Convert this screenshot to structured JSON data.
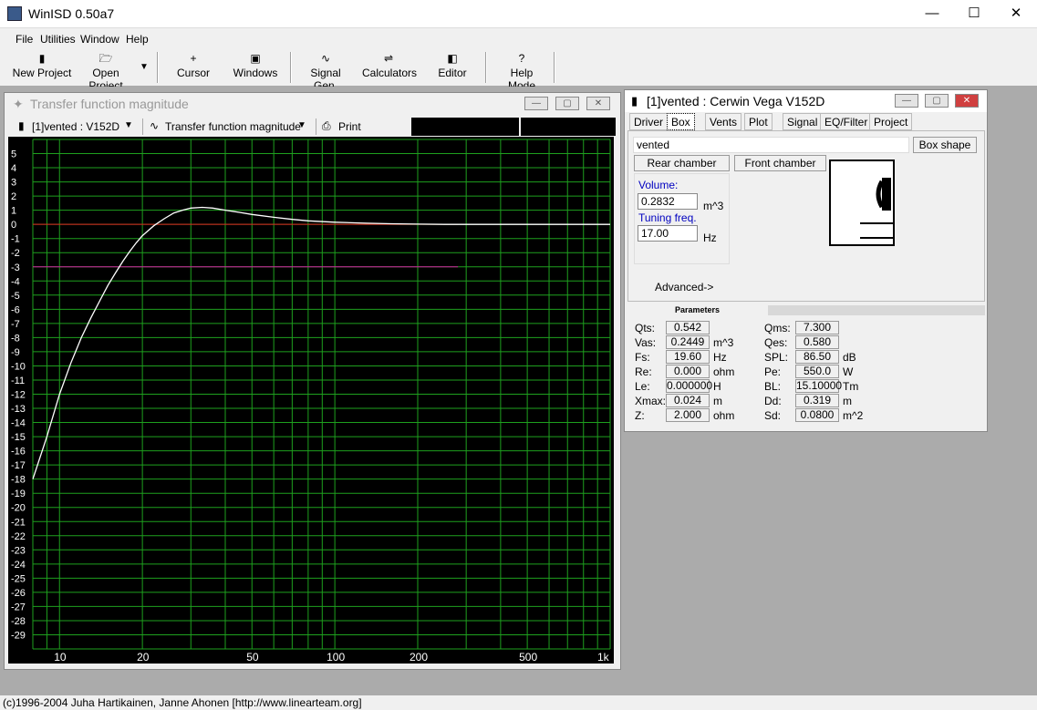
{
  "app": {
    "title": "WinISD 0.50a7"
  },
  "window_controls": {
    "minimize": "—",
    "maximize": "☐",
    "close": "✕"
  },
  "menu": [
    "File",
    "Utilities",
    "Window",
    "Help"
  ],
  "toolbar": {
    "new_project": "New Project",
    "open_project": "Open Project",
    "cursor": "Cursor",
    "windows": "Windows",
    "signal_gen": "Signal Gen.",
    "calculators": "Calculators",
    "editor": "Editor",
    "help_mode": "Help Mode"
  },
  "graph_window": {
    "title": "Transfer function magnitude",
    "project_select": "[1]vented : V152D",
    "graph_select": "Transfer function magnitude",
    "print": "Print"
  },
  "chart_data": {
    "type": "line",
    "xscale": "log",
    "xlim": [
      8,
      1000
    ],
    "ylim": [
      -30,
      6
    ],
    "grid": true,
    "xticks": [
      "10",
      "20",
      "50",
      "100",
      "200",
      "500",
      "1k"
    ],
    "yticks": [
      "5",
      "4",
      "3",
      "2",
      "1",
      "0",
      "-1",
      "-2",
      "-3",
      "-4",
      "-5",
      "-6",
      "-7",
      "-8",
      "-9",
      "-10",
      "-11",
      "-12",
      "-13",
      "-14",
      "-15",
      "-16",
      "-17",
      "-18",
      "-19",
      "-20",
      "-21",
      "-22",
      "-23",
      "-24",
      "-25",
      "-26",
      "-27",
      "-28",
      "-29"
    ],
    "reference_lines": [
      {
        "y": 0,
        "color": "#e02020"
      },
      {
        "y": -3,
        "color": "#d020a0"
      }
    ],
    "colors": {
      "background": "#000000",
      "grid": "#1ea01e",
      "curve": "#ffffff",
      "text": "#ffffff"
    },
    "series": [
      {
        "x": [
          8,
          9,
          10,
          11,
          12,
          13,
          14,
          15,
          16,
          17,
          18,
          19,
          20,
          22,
          24,
          26,
          28,
          30,
          33,
          36,
          40,
          45,
          50,
          60,
          70,
          80,
          100,
          130,
          160,
          200,
          250,
          300,
          400,
          500,
          700,
          1000
        ],
        "y": [
          -18.0,
          -15.0,
          -12.0,
          -9.8,
          -8.0,
          -6.6,
          -5.4,
          -4.3,
          -3.4,
          -2.6,
          -1.9,
          -1.3,
          -0.8,
          -0.1,
          0.4,
          0.8,
          1.0,
          1.15,
          1.2,
          1.15,
          1.0,
          0.85,
          0.7,
          0.5,
          0.35,
          0.25,
          0.15,
          0.08,
          0.04,
          0.02,
          0.0,
          0.0,
          0.0,
          0.0,
          0.0,
          0.0
        ]
      }
    ]
  },
  "box_window": {
    "title": "[1]vented : Cerwin Vega V152D",
    "tabs": [
      "Driver",
      "Box",
      "Vents",
      "Plot",
      "Signal",
      "EQ/Filter",
      "Project"
    ],
    "box_type": "vented",
    "box_shape": "Box shape",
    "rear_chamber": "Rear chamber",
    "front_chamber": "Front chamber",
    "volume_label": "Volume:",
    "volume_value": "0.2832",
    "volume_unit": "m^3",
    "tuning_label": "Tuning freq.",
    "tuning_value": "17.00",
    "tuning_unit": "Hz",
    "advanced": "Advanced->"
  },
  "parameters": {
    "header": "Parameters",
    "left": [
      {
        "label": "Qts:",
        "value": "0.542",
        "unit": ""
      },
      {
        "label": "Vas:",
        "value": "0.2449",
        "unit": "m^3"
      },
      {
        "label": "Fs:",
        "value": "19.60",
        "unit": "Hz"
      },
      {
        "label": "Re:",
        "value": "0.000",
        "unit": "ohm"
      },
      {
        "label": "Le:",
        "value": "0.000000",
        "unit": "H"
      },
      {
        "label": "Xmax:",
        "value": "0.024",
        "unit": "m"
      },
      {
        "label": "Z:",
        "value": "2.000",
        "unit": "ohm"
      }
    ],
    "right": [
      {
        "label": "Qms:",
        "value": "7.300",
        "unit": ""
      },
      {
        "label": "Qes:",
        "value": "0.580",
        "unit": ""
      },
      {
        "label": "SPL:",
        "value": "86.50",
        "unit": "dB"
      },
      {
        "label": "Pe:",
        "value": "550.0",
        "unit": "W"
      },
      {
        "label": "BL:",
        "value": "15.10000",
        "unit": "Tm"
      },
      {
        "label": "Dd:",
        "value": "0.319",
        "unit": "m"
      },
      {
        "label": "Sd:",
        "value": "0.0800",
        "unit": "m^2"
      }
    ]
  },
  "status": {
    "text": "(c)1996-2004 Juha Hartikainen, Janne Ahonen [http://www.linearteam.org]"
  }
}
